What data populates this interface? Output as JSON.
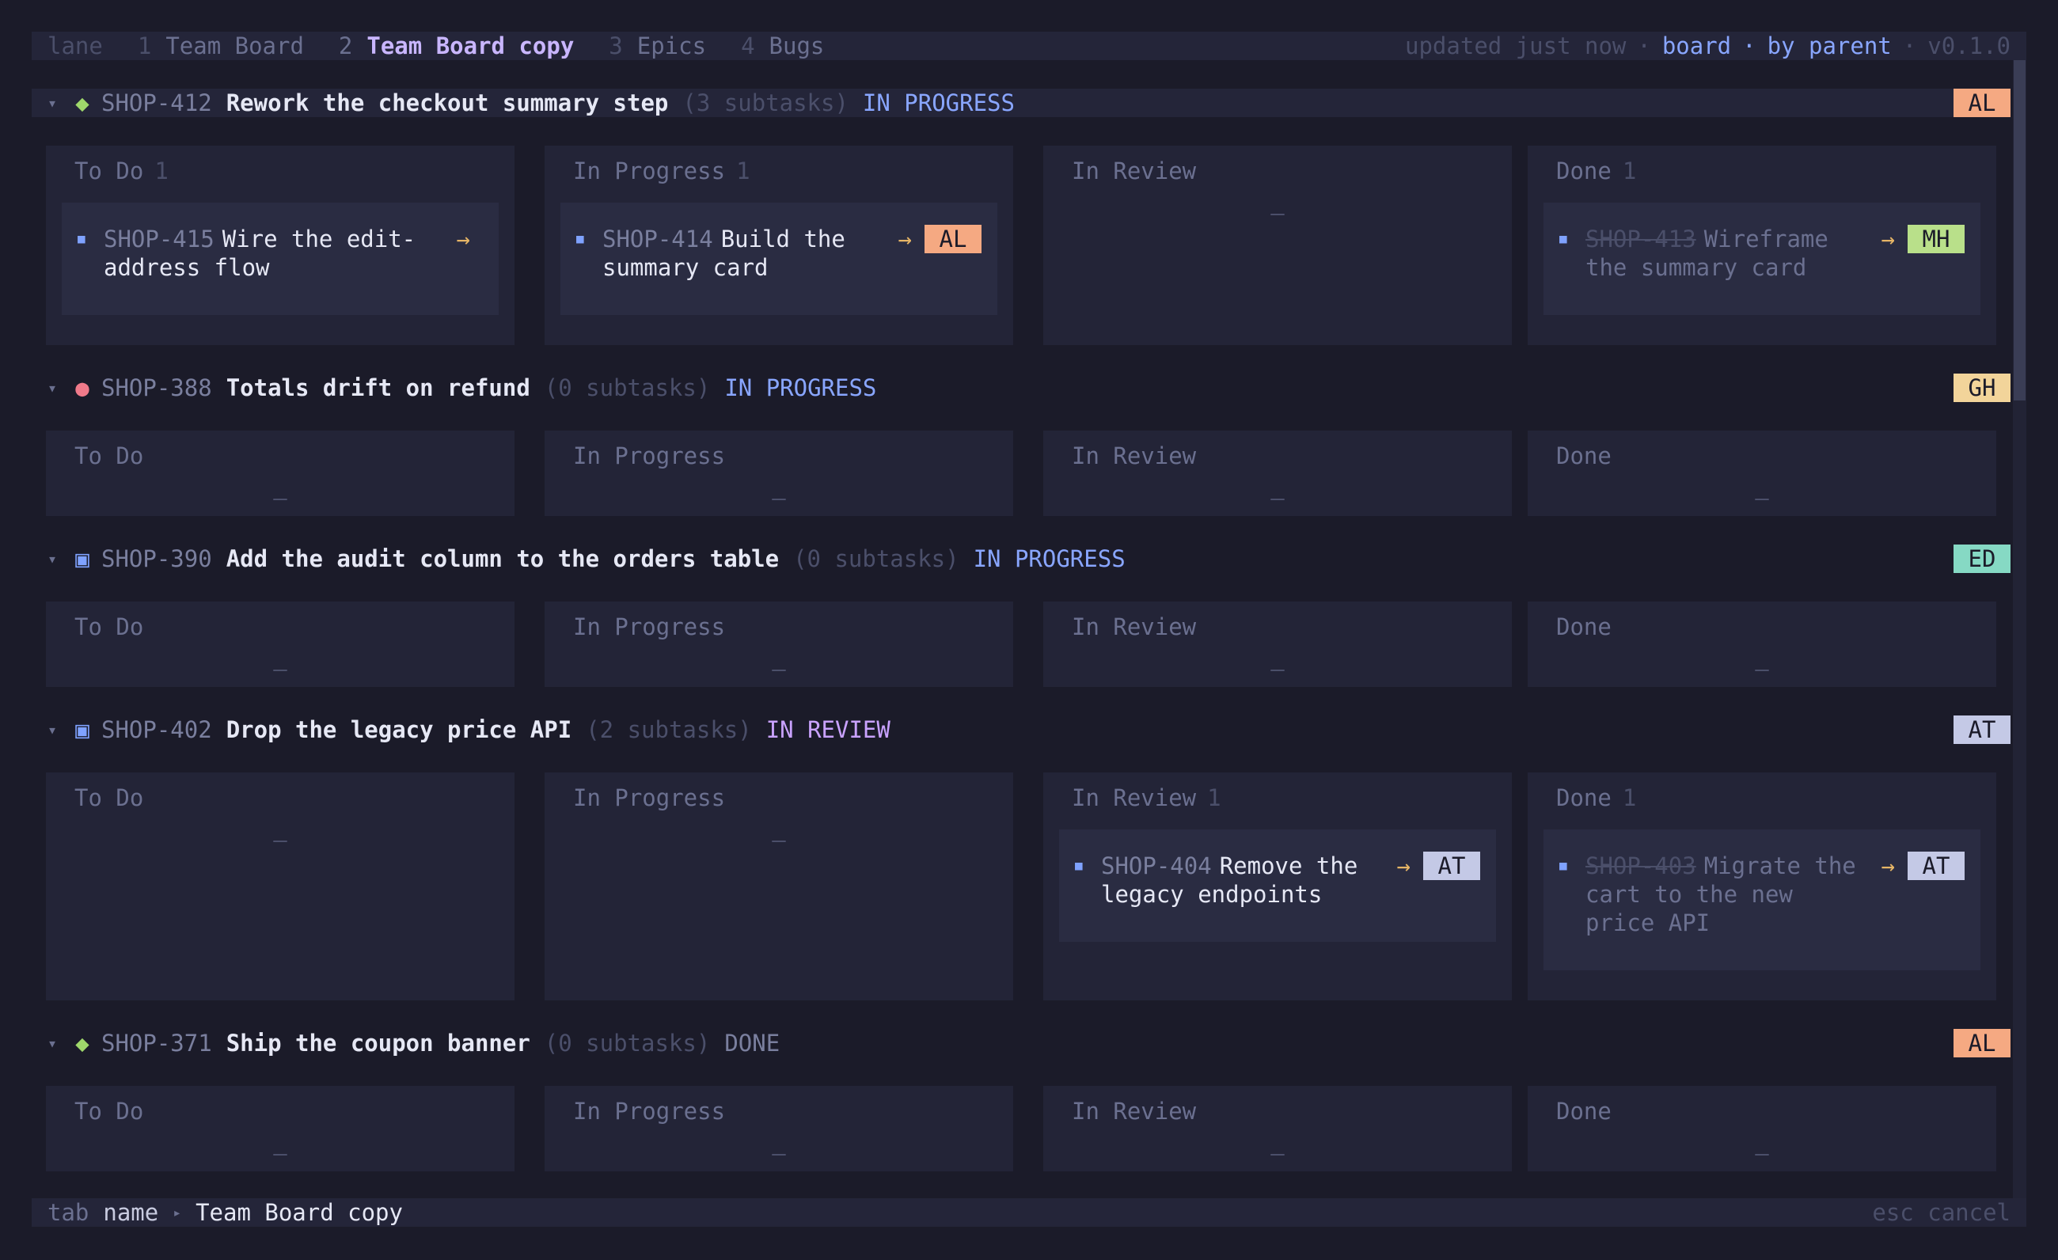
{
  "topbar": {
    "app": "lane",
    "tabs": [
      {
        "num": "1",
        "label": "Team Board"
      },
      {
        "num": "2",
        "label": "Team Board copy"
      },
      {
        "num": "3",
        "label": "Epics"
      },
      {
        "num": "4",
        "label": "Bugs"
      }
    ],
    "status": {
      "updated": "updated just now",
      "sep": "·",
      "view": "board",
      "group": "by parent",
      "version": "v0.1.0"
    }
  },
  "colors": {
    "in_progress": "#89a6ff",
    "in_review": "#c9a2ff",
    "done": "#7a7f9e",
    "AL": "#f5a982",
    "GH": "#f2d49a",
    "ED": "#86d9c4",
    "AT": "#c4c9e6",
    "MH": "#b9e08a"
  },
  "columns": [
    "To Do",
    "In Progress",
    "In Review",
    "Done"
  ],
  "empty_marker": "—",
  "lanes": [
    {
      "glyph": "◆",
      "glyph_icon": "epic-diamond-icon",
      "glyph_color": "#9fd86b",
      "key": "SHOP-412",
      "title": "Rework the checkout summary step",
      "count": "(3 subtasks)",
      "status": "IN PROGRESS",
      "assignee": "AL",
      "col_counts": [
        "1",
        "1",
        "",
        "1"
      ],
      "cards": {
        "todo": {
          "key": "SHOP-415",
          "title": "Wire the edit-address flow",
          "arrow": "→"
        },
        "inprog": {
          "key": "SHOP-414",
          "title": "Build the summary card",
          "arrow": "→",
          "assignee": "AL"
        },
        "done": {
          "key": "SHOP-413",
          "title": "Wireframe the summary card",
          "arrow": "→",
          "assignee": "MH"
        }
      }
    },
    {
      "glyph": "●",
      "glyph_icon": "bug-dot-icon",
      "glyph_color": "#f07a8a",
      "key": "SHOP-388",
      "title": "Totals drift on refund",
      "count": "(0 subtasks)",
      "status": "IN PROGRESS",
      "assignee": "GH"
    },
    {
      "glyph": "▣",
      "glyph_icon": "story-square-icon",
      "glyph_color": "#7fa2ff",
      "key": "SHOP-390",
      "title": "Add the audit column to the orders table",
      "count": "(0 subtasks)",
      "status": "IN PROGRESS",
      "assignee": "ED"
    },
    {
      "glyph": "▣",
      "glyph_icon": "story-square-icon",
      "glyph_color": "#7fa2ff",
      "key": "SHOP-402",
      "title": "Drop the legacy price API",
      "count": "(2 subtasks)",
      "status": "IN REVIEW",
      "assignee": "AT",
      "col_counts": [
        "",
        "",
        "1",
        "1"
      ],
      "cards": {
        "review": {
          "key": "SHOP-404",
          "title": "Remove the legacy endpoints",
          "arrow": "→",
          "assignee": "AT"
        },
        "done": {
          "key": "SHOP-403",
          "title": "Migrate the cart to the new price API",
          "arrow": "→",
          "assignee": "AT"
        }
      }
    },
    {
      "glyph": "◆",
      "glyph_icon": "epic-diamond-icon",
      "glyph_color": "#9fd86b",
      "key": "SHOP-371",
      "title": "Ship the coupon banner",
      "count": "(0 subtasks)",
      "status": "DONE",
      "assignee": "AL"
    }
  ],
  "footer": {
    "key": "tab",
    "label": "name",
    "value": "Team Board copy",
    "hint": "esc cancel"
  }
}
